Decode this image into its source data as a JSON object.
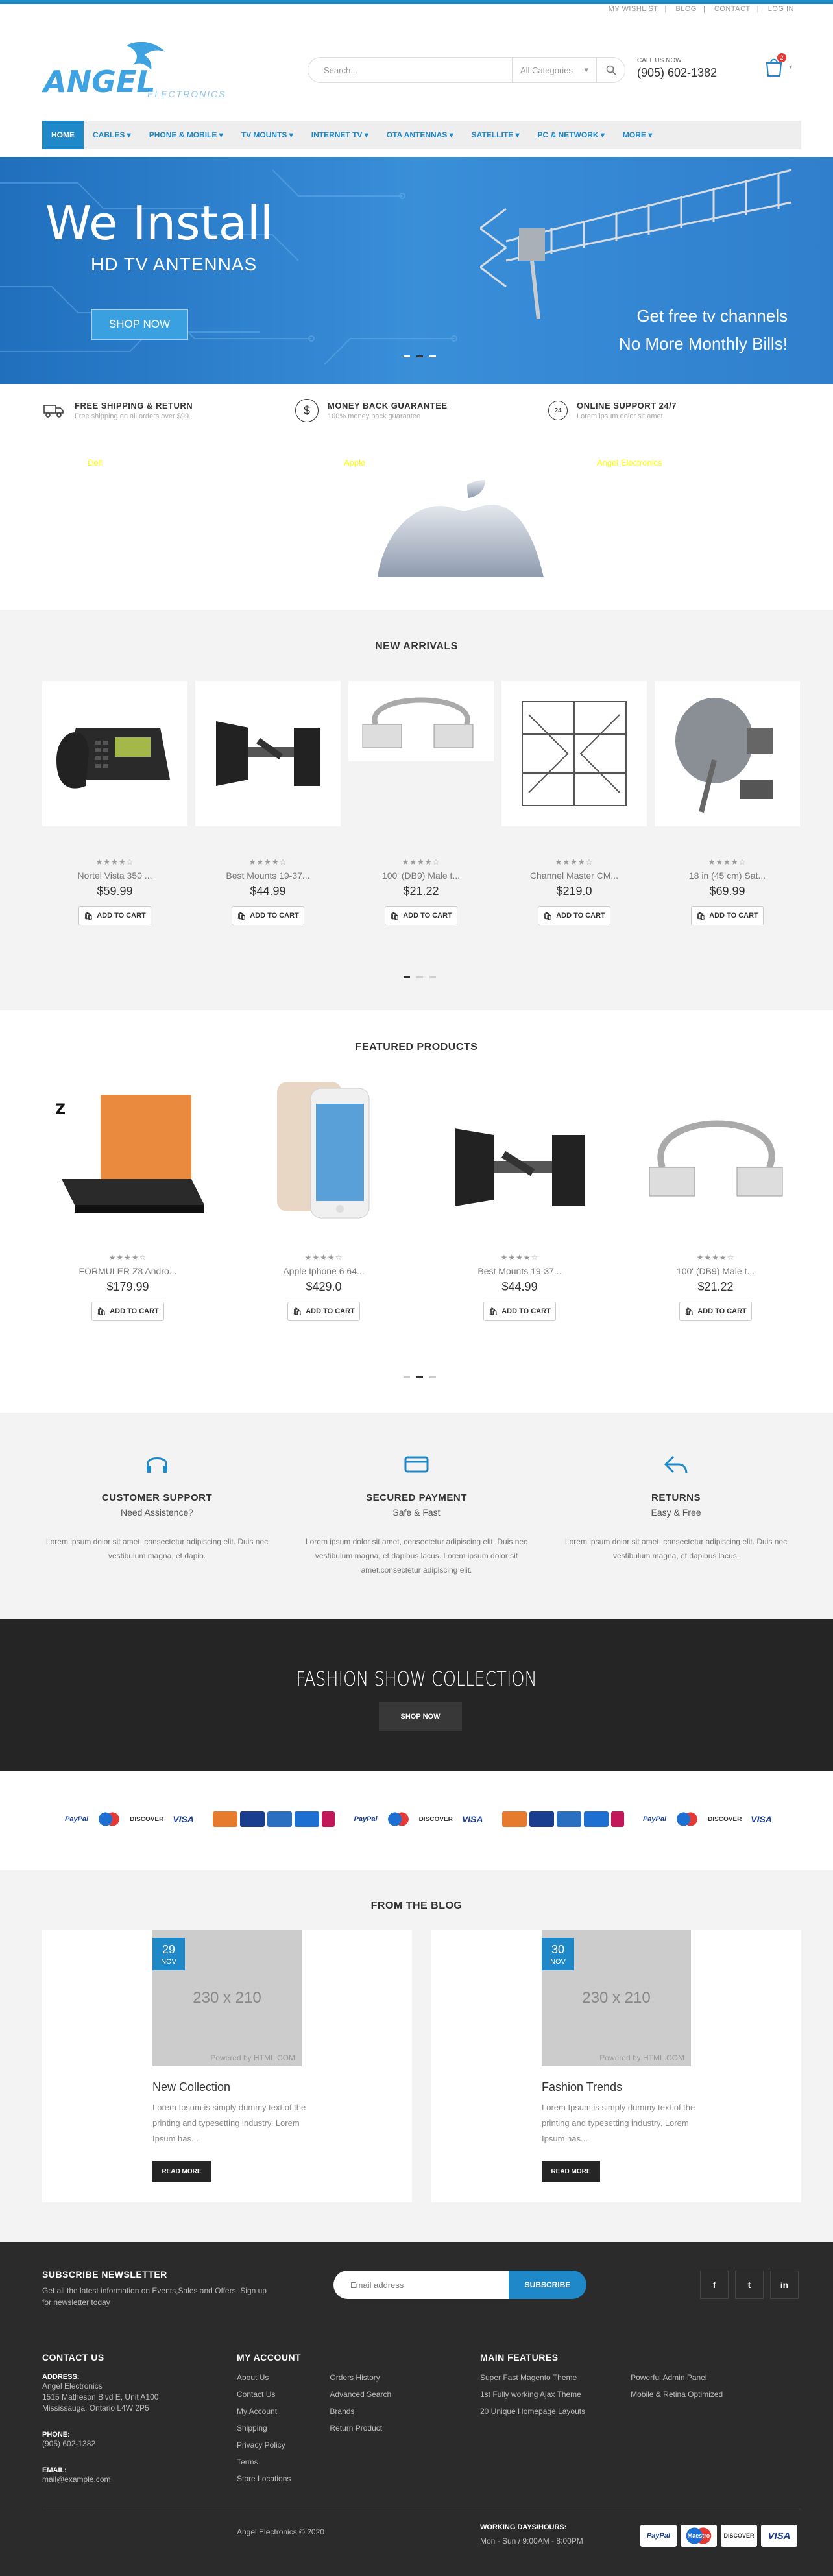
{
  "top_links": [
    "MY WISHLIST",
    "BLOG",
    "CONTACT",
    "LOG IN"
  ],
  "logo": {
    "brand": "ANGEL",
    "sub": "ELECTRONICS"
  },
  "search": {
    "placeholder": "Search...",
    "category": "All Categories"
  },
  "call": {
    "label": "CALL US NOW",
    "number": "(905) 602-1382"
  },
  "cart": {
    "count": "2"
  },
  "nav": [
    "HOME",
    "CABLES",
    "PHONE & MOBILE",
    "TV MOUNTS",
    "INTERNET TV",
    "OTA ANTENNAS",
    "SATELLITE",
    "PC & NETWORK",
    "MORE"
  ],
  "hero": {
    "title": "We Install",
    "subtitle": "HD TV ANTENNAS",
    "button": "SHOP NOW",
    "line1": "Get free tv channels",
    "line2": "No More Monthly Bills!"
  },
  "features": [
    {
      "title": "FREE SHIPPING & RETURN",
      "sub": "Free shipping on all orders over $99.",
      "icon": "truck-icon"
    },
    {
      "title": "MONEY BACK GUARANTEE",
      "sub": "100% money back guarantee",
      "icon": "dollar-icon"
    },
    {
      "title": "ONLINE SUPPORT 24/7",
      "sub": "Lorem ipsum dolor sit amet.",
      "icon": "clock-24-icon"
    }
  ],
  "brands": [
    "Dell",
    "Apple",
    "Angel Electronics"
  ],
  "new_arrivals": {
    "title": "NEW ARRIVALS",
    "items": [
      {
        "name": "Nortel Vista 350 ...",
        "price": "$59.99",
        "rating": 4
      },
      {
        "name": "Best Mounts 19-37...",
        "price": "$44.99",
        "rating": 4
      },
      {
        "name": "100' (DB9) Male t...",
        "price": "$21.22",
        "rating": 4
      },
      {
        "name": "Channel Master CM...",
        "price": "$219.0",
        "rating": 4
      },
      {
        "name": "18 in (45 cm) Sat...",
        "price": "$69.99",
        "rating": 4
      }
    ],
    "add_to_cart": "ADD TO CART"
  },
  "featured": {
    "title": "FEATURED PRODUCTS",
    "items": [
      {
        "name": "FORMULER Z8 Andro...",
        "price": "$179.99",
        "rating": 4
      },
      {
        "name": "Apple Iphone 6 64...",
        "price": "$429.0",
        "rating": 4
      },
      {
        "name": "Best Mounts 19-37...",
        "price": "$44.99",
        "rating": 4
      },
      {
        "name": "100' (DB9) Male t...",
        "price": "$21.22",
        "rating": 4
      }
    ],
    "add_to_cart": "ADD TO CART"
  },
  "services": [
    {
      "title": "CUSTOMER SUPPORT",
      "sub": "Need Assistence?",
      "desc": "Lorem ipsum dolor sit amet, consectetur adipiscing elit. Duis nec vestibulum magna, et dapib.",
      "icon": "headset-icon"
    },
    {
      "title": "SECURED PAYMENT",
      "sub": "Safe & Fast",
      "desc": "Lorem ipsum dolor sit amet, consectetur adipiscing elit. Duis nec vestibulum magna, et dapibus lacus. Lorem ipsum dolor sit amet.consectetur adipiscing elit.",
      "icon": "credit-card-icon"
    },
    {
      "title": "RETURNS",
      "sub": "Easy & Free",
      "desc": "Lorem ipsum dolor sit amet, consectetur adipiscing elit. Duis nec vestibulum magna, et dapibus lacus.",
      "icon": "return-arrow-icon"
    }
  ],
  "fashion": {
    "title": "FASHION SHOW COLLECTION",
    "button": "SHOP NOW"
  },
  "blog": {
    "title": "FROM THE BLOG",
    "posts": [
      {
        "day": "29",
        "month": "NOV",
        "placeholder": "230 x 210",
        "powered": "Powered by HTML.COM",
        "title": "New Collection",
        "excerpt": "Lorem Ipsum is simply dummy text of the printing and typesetting industry. Lorem Ipsum has...",
        "button": "READ MORE"
      },
      {
        "day": "30",
        "month": "NOV",
        "placeholder": "230 x 210",
        "powered": "Powered by HTML.COM",
        "title": "Fashion Trends",
        "excerpt": "Lorem Ipsum is simply dummy text of the printing and typesetting industry. Lorem Ipsum has...",
        "button": "READ MORE"
      }
    ]
  },
  "footer": {
    "newsletter_title": "SUBSCRIBE NEWSLETTER",
    "newsletter_text": "Get all the latest information on Events,Sales and Offers. Sign up for newsletter today",
    "email_placeholder": "Email address",
    "subscribe": "SUBSCRIBE",
    "social": [
      "f",
      "t",
      "in"
    ],
    "contact_title": "CONTACT US",
    "address_label": "ADDRESS:",
    "address_lines": [
      "Angel Electronics",
      "1515 Matheson Blvd E, Unit A100",
      "Mississauga, Ontario L4W 2P5"
    ],
    "phone_label": "PHONE:",
    "phone": "(905) 602-1382",
    "email_label": "EMAIL:",
    "email": "mail@example.com",
    "account_title": "MY ACCOUNT",
    "account_col1": [
      "About Us",
      "Contact Us",
      "My Account",
      "Shipping",
      "Privacy Policy",
      "Terms",
      "Store Locations"
    ],
    "account_col2": [
      "Orders History",
      "Advanced Search",
      "Brands",
      "Return Product"
    ],
    "features_title": "MAIN FEATURES",
    "features_col1": [
      "Super Fast Magento Theme",
      "1st Fully working Ajax Theme",
      "20 Unique Homepage Layouts"
    ],
    "features_col2": [
      "Powerful Admin Panel",
      "Mobile & Retina Optimized"
    ],
    "copyright": "Angel Electronics © 2020",
    "hours_label": "WORKING DAYS/HOURS:",
    "hours": "Mon - Sun / 9:00AM - 8:00PM",
    "payments": [
      "PayPal",
      "Maestro",
      "DISCOVER",
      "VISA"
    ]
  },
  "colors": {
    "accent": "#1e88c9",
    "dark": "#252525",
    "footer": "#2b2b2b"
  }
}
